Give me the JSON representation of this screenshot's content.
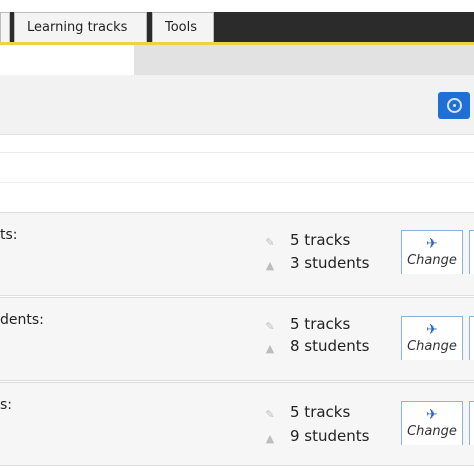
{
  "header": {
    "tabs": [
      {
        "label": ""
      },
      {
        "label": "Learning tracks"
      },
      {
        "label": "Tools"
      }
    ]
  },
  "groups": [
    {
      "title": "ts:",
      "tracks": "5 tracks",
      "students": "3 students",
      "change_label": "Change"
    },
    {
      "title": "dents:",
      "tracks": "5 tracks",
      "students": "8 students",
      "change_label": "Change"
    },
    {
      "title": "s:",
      "tracks": "5 tracks",
      "students": "9 students",
      "change_label": "Change"
    }
  ],
  "colors": {
    "accent": "#e8d34a",
    "primary": "#1f6fd6",
    "header": "#2b2b2b"
  },
  "icons": {
    "add": "plus-circle-icon",
    "tracks": "pin-icon",
    "students": "user-icon",
    "change": "arrows-icon"
  }
}
